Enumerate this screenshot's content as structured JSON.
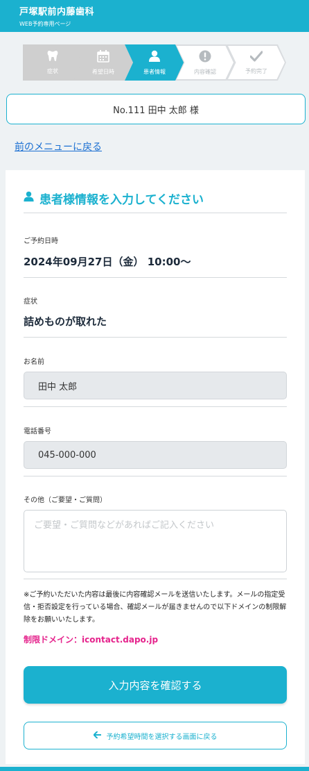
{
  "header": {
    "clinic_name": "戸塚駅前内藤歯科",
    "subtitle": "WEB予約専用ページ"
  },
  "steps": [
    {
      "label": "症状",
      "state": "done",
      "icon": "tooth-icon"
    },
    {
      "label": "希望日時",
      "state": "done",
      "icon": "calendar-icon"
    },
    {
      "label": "患者情報",
      "state": "current",
      "icon": "person-icon"
    },
    {
      "label": "内容確認",
      "state": "todo",
      "icon": "exclamation-icon"
    },
    {
      "label": "予約完了",
      "state": "todo",
      "icon": "check-icon"
    }
  ],
  "patient": {
    "display": "No.111 田中 太郎 様"
  },
  "nav": {
    "back_menu": "前のメニューに戻る"
  },
  "form": {
    "title": "患者様情報を入力してください",
    "date_label": "ご予約日時",
    "date_value": "2024年09月27日（金） 10:00〜",
    "symptom_label": "症状",
    "symptom_value": "詰めものが取れた",
    "name_label": "お名前",
    "name_value": "田中 太郎",
    "phone_label": "電話番号",
    "phone_value": "045-000-000",
    "other_label": "その他（ご要望・ご質問）",
    "other_placeholder": "ご要望・ご質問などがあればご記入ください",
    "note": "※ご予約いただいた内容は最後に内容確認メールを送信いたします。メールの指定受信・拒否設定を行っている場合、確認メールが届きませんので以下ドメインの制限解除をお願いいたします。",
    "domain": "制限ドメイン：icontact.dapo.jp",
    "confirm_button": "入力内容を確認する",
    "return_button": "予約希望時間を選択する画面に戻る"
  },
  "colors": {
    "accent": "#1bb1cf",
    "link": "#1a6fd2",
    "warning": "#e5238c"
  }
}
